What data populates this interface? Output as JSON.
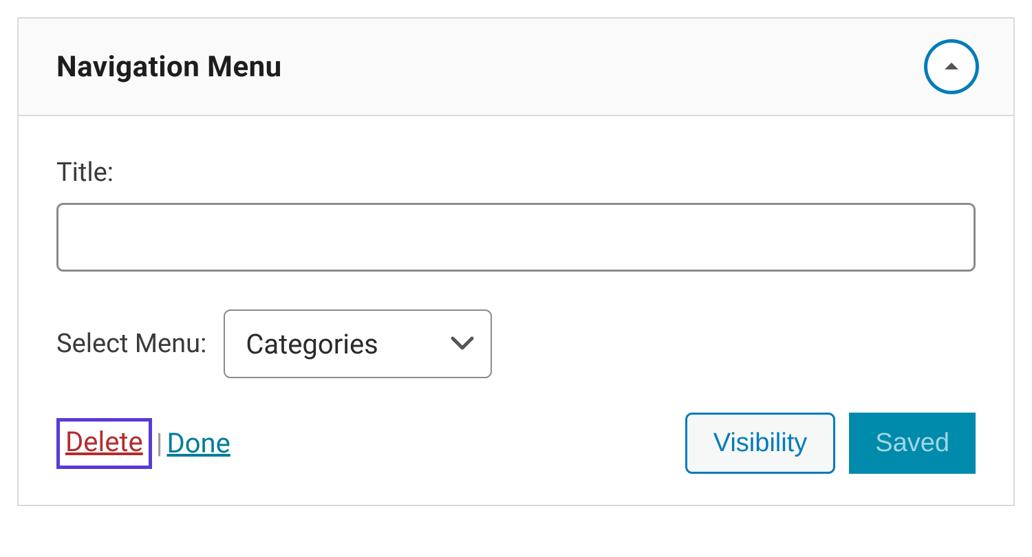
{
  "widget": {
    "title": "Navigation Menu",
    "fields": {
      "title_label": "Title:",
      "title_value": "",
      "select_menu_label": "Select Menu:",
      "select_menu_value": "Categories"
    },
    "actions": {
      "delete": "Delete",
      "separator": "|",
      "done": "Done",
      "visibility": "Visibility",
      "saved": "Saved"
    }
  }
}
